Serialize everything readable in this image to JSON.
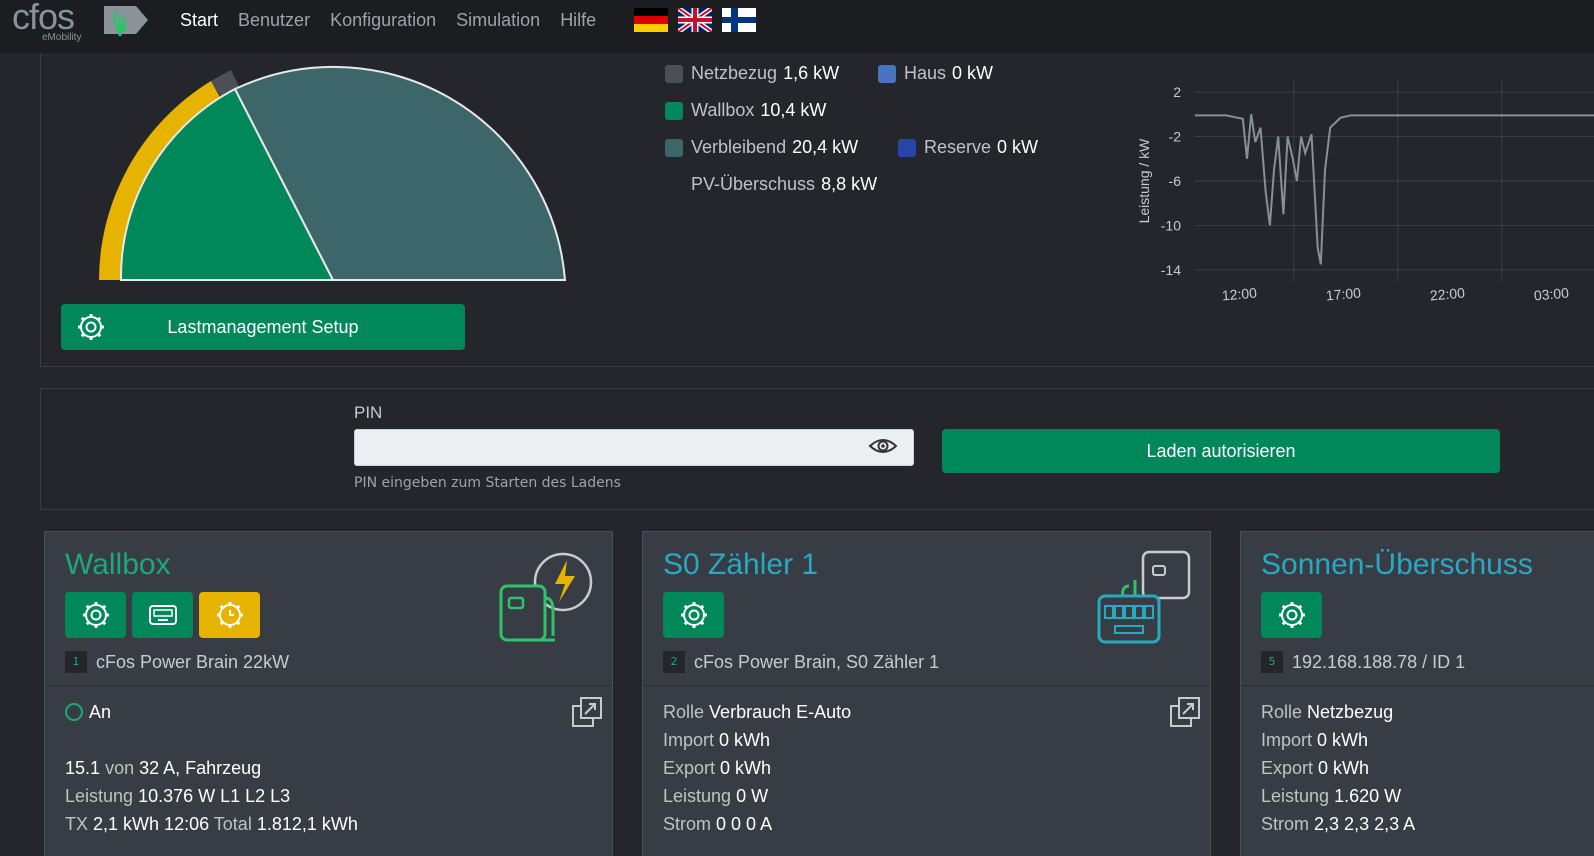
{
  "logo": {
    "text": "cfos",
    "sub": "eMobility"
  },
  "nav": {
    "items": [
      "Start",
      "Benutzer",
      "Konfiguration",
      "Simulation",
      "Hilfe"
    ],
    "active": "Start",
    "languages": [
      "de",
      "en",
      "fi"
    ]
  },
  "overview": {
    "legend": [
      {
        "label": "Netzbezug",
        "value": "1,6 kW",
        "color": "#4a5055"
      },
      {
        "label": "Haus",
        "value": "0 kW",
        "color": "#4a74c2"
      },
      {
        "label": "Wallbox",
        "value": "10,4 kW",
        "color": "#00885a"
      },
      {
        "label": "Verbleibend",
        "value": "20,4 kW",
        "color": "#3d666b"
      },
      {
        "label": "Reserve",
        "value": "0 kW",
        "color": "#2546a6"
      },
      {
        "label": "PV-Überschuss",
        "value": "8,8 kW",
        "color": ""
      }
    ],
    "gauge": {
      "segments": [
        {
          "name": "Wallbox",
          "value": 10.4,
          "color": "#00885a"
        },
        {
          "name": "Verbleibend",
          "value": 20.4,
          "color": "#3d666b"
        },
        {
          "name": "Netzbezug",
          "value": 1.6,
          "color": "#4a5055"
        }
      ],
      "pv_arc_value": 8.8,
      "pv_arc_color": "#e6b400"
    },
    "setup_button": "Lastmanagement Setup"
  },
  "chart_data": {
    "type": "line",
    "ylabel": "Leistung / kW",
    "yticks": [
      2,
      -2,
      -6,
      -10,
      -14
    ],
    "xticks": [
      "12:00",
      "17:00",
      "22:00",
      "03:00"
    ],
    "ylim": [
      -15,
      3
    ],
    "grid": true,
    "series": [
      {
        "values": [
          [
            0,
            -0.1
          ],
          [
            3,
            -0.1
          ],
          [
            4.6,
            -0.4
          ],
          [
            5,
            -4
          ],
          [
            5.4,
            0
          ],
          [
            5.8,
            -2.5
          ],
          [
            6.3,
            -1.2
          ],
          [
            6.8,
            -7
          ],
          [
            7.2,
            -10
          ],
          [
            7.6,
            -5
          ],
          [
            8.0,
            -2
          ],
          [
            8.5,
            -9
          ],
          [
            8.9,
            -2
          ],
          [
            9.4,
            -4
          ],
          [
            9.8,
            -6
          ],
          [
            10.2,
            -2
          ],
          [
            10.6,
            -3.5
          ],
          [
            11.2,
            -1.8
          ],
          [
            11.8,
            -12
          ],
          [
            12.1,
            -13.5
          ],
          [
            12.5,
            -5
          ],
          [
            13,
            -1.2
          ],
          [
            14,
            -0.3
          ],
          [
            15,
            -0.1
          ],
          [
            40,
            -0.1
          ]
        ]
      }
    ]
  },
  "pin": {
    "label": "PIN",
    "value": "",
    "help": "PIN eingeben zum Starten des Ladens",
    "authorize_button": "Laden autorisieren"
  },
  "cards": [
    {
      "title": "Wallbox",
      "title_color": "#1ea87a",
      "id": "1",
      "subtitle": "cFos Power Brain 22kW",
      "status": "An",
      "line1": {
        "current": "15.1",
        "von": "von",
        "max": "32 A, Fahrzeug"
      },
      "line2": {
        "k": "Leistung",
        "v": "10.376 W L1 L2 L3"
      },
      "line3": {
        "k1": "TX",
        "v1": "2,1 kWh 12:06",
        "k2": "Total",
        "v2": "1.812,1 kWh"
      }
    },
    {
      "title": "S0 Zähler 1",
      "title_color": "#29a8c2",
      "id": "2",
      "subtitle": "cFos Power Brain, S0 Zähler 1",
      "rows": [
        {
          "k": "Rolle",
          "v": "Verbrauch E-Auto"
        },
        {
          "k": "Import",
          "v": "0 kWh"
        },
        {
          "k": "Export",
          "v": "0 kWh"
        },
        {
          "k": "Leistung",
          "v": "0 W"
        },
        {
          "k": "Strom",
          "v": "0 0 0 A"
        }
      ]
    },
    {
      "title": "Sonnen-Überschuss",
      "title_color": "#29a8c2",
      "id": "5",
      "subtitle": "192.168.188.78 / ID 1",
      "rows": [
        {
          "k": "Rolle",
          "v": "Netzbezug"
        },
        {
          "k": "Import",
          "v": "0 kWh"
        },
        {
          "k": "Export",
          "v": "0 kWh"
        },
        {
          "k": "Leistung",
          "v": "1.620 W"
        },
        {
          "k": "Strom",
          "v": "2,3 2,3 2,3 A"
        }
      ]
    }
  ]
}
